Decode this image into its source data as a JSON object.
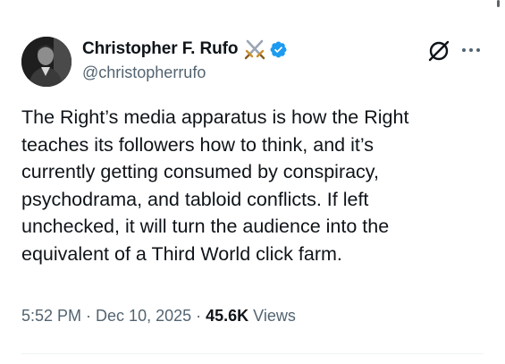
{
  "author": {
    "display_name": "Christopher F. Rufo",
    "handle": "@christopherrufo",
    "name_emoji": "crossed-swords-icon",
    "verified_badge": "verified-check-icon",
    "verified_color": "#1d9bf0"
  },
  "header_actions": {
    "grok_icon": "grok-icon",
    "more_icon": "more-options-icon"
  },
  "tweet": {
    "lines": [
      "The Right’s media apparatus is how the Right",
      "teaches its followers how to think, and it’s",
      "currently getting consumed by conspiracy,",
      "psychodrama, and tabloid conflicts. If left",
      "unchecked, it will turn the audience into the",
      "equivalent of a Third World click farm."
    ]
  },
  "meta": {
    "time": "5:52 PM",
    "separator": "·",
    "date": "Dec 10, 2025",
    "views_count": "45.6K",
    "views_label": "Views"
  },
  "colors": {
    "text_primary": "#0f1419",
    "text_secondary": "#536471",
    "accent": "#1d9bf0"
  }
}
